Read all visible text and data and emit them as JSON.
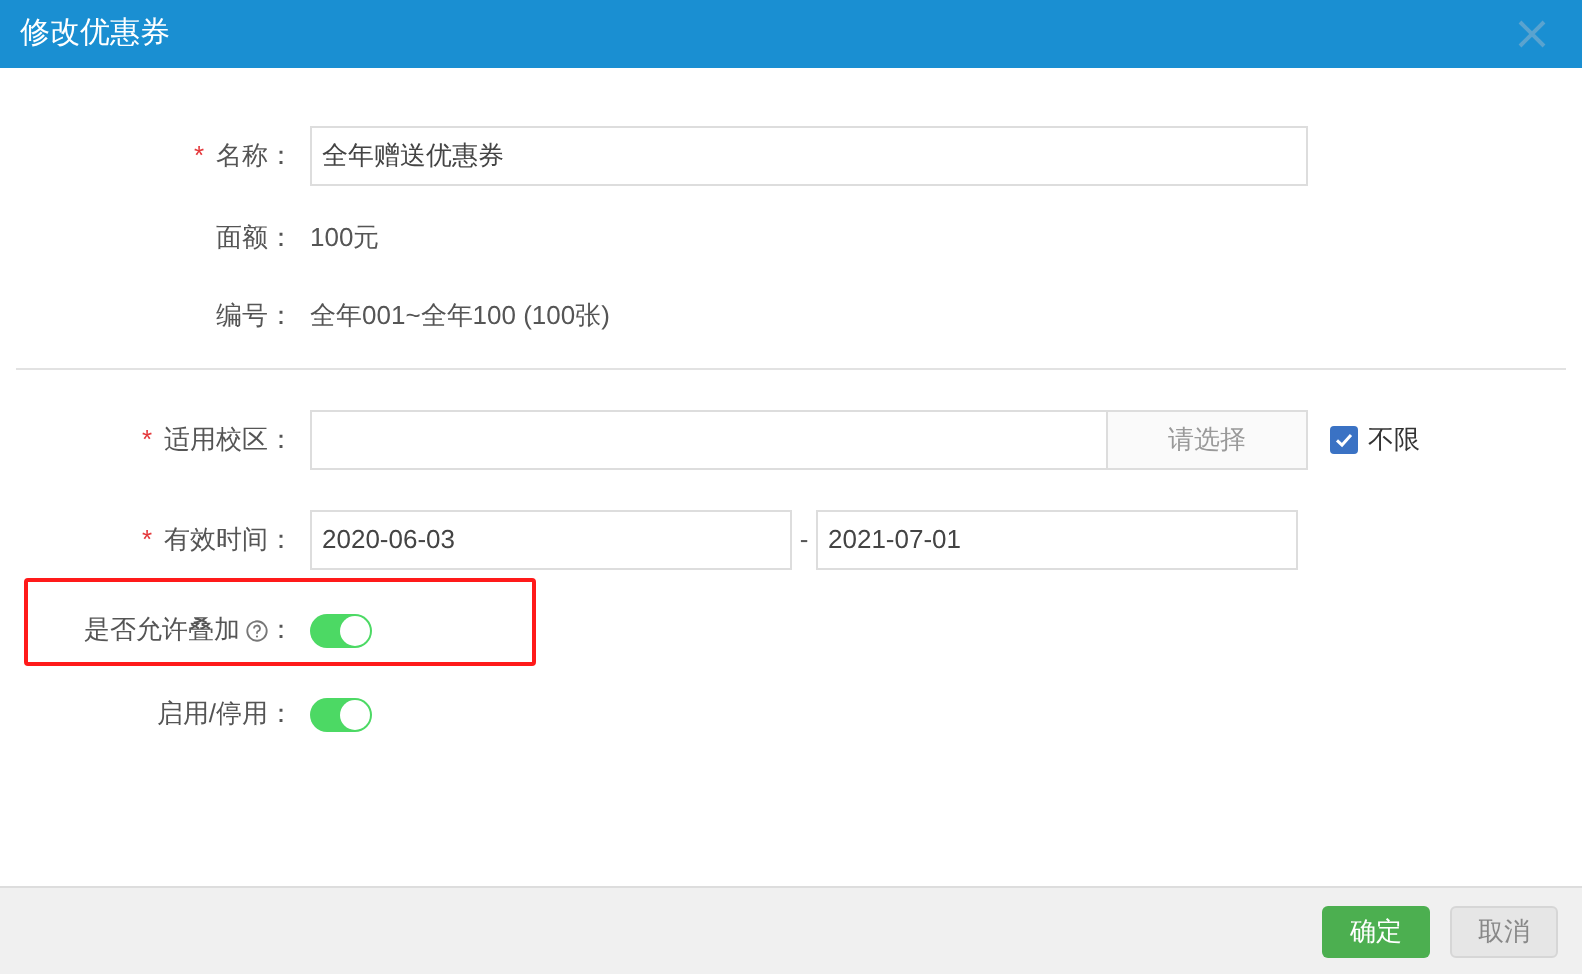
{
  "dialog": {
    "title": "修改优惠券"
  },
  "fields": [
    {
      "kind": "input",
      "marker": "*",
      "label": "名称：",
      "value": "全年赠送优惠券"
    },
    {
      "kind": "text",
      "label": "面额：",
      "value": "100元"
    },
    {
      "kind": "text",
      "label": "编号：",
      "value": "全年001~全年100 (100张)"
    }
  ],
  "campus": {
    "marker": "*",
    "label": "适用校区：",
    "button": "请选择",
    "checkbox": {
      "label": "不限",
      "checked": true
    }
  },
  "validity": {
    "marker": "*",
    "label": "有效时间：",
    "start": "2020-06-03",
    "separator": "-",
    "end": "2021-07-01"
  },
  "toggles": [
    {
      "label": "是否允许叠加",
      "help": true,
      "colon": "：",
      "on": true,
      "highlighted": true
    },
    {
      "label": "启用/停用：",
      "help": false,
      "on": true,
      "highlighted": false
    }
  ],
  "buttons": [
    {
      "kind": "primary",
      "label": "确定"
    },
    {
      "kind": "default",
      "label": "取消"
    }
  ]
}
